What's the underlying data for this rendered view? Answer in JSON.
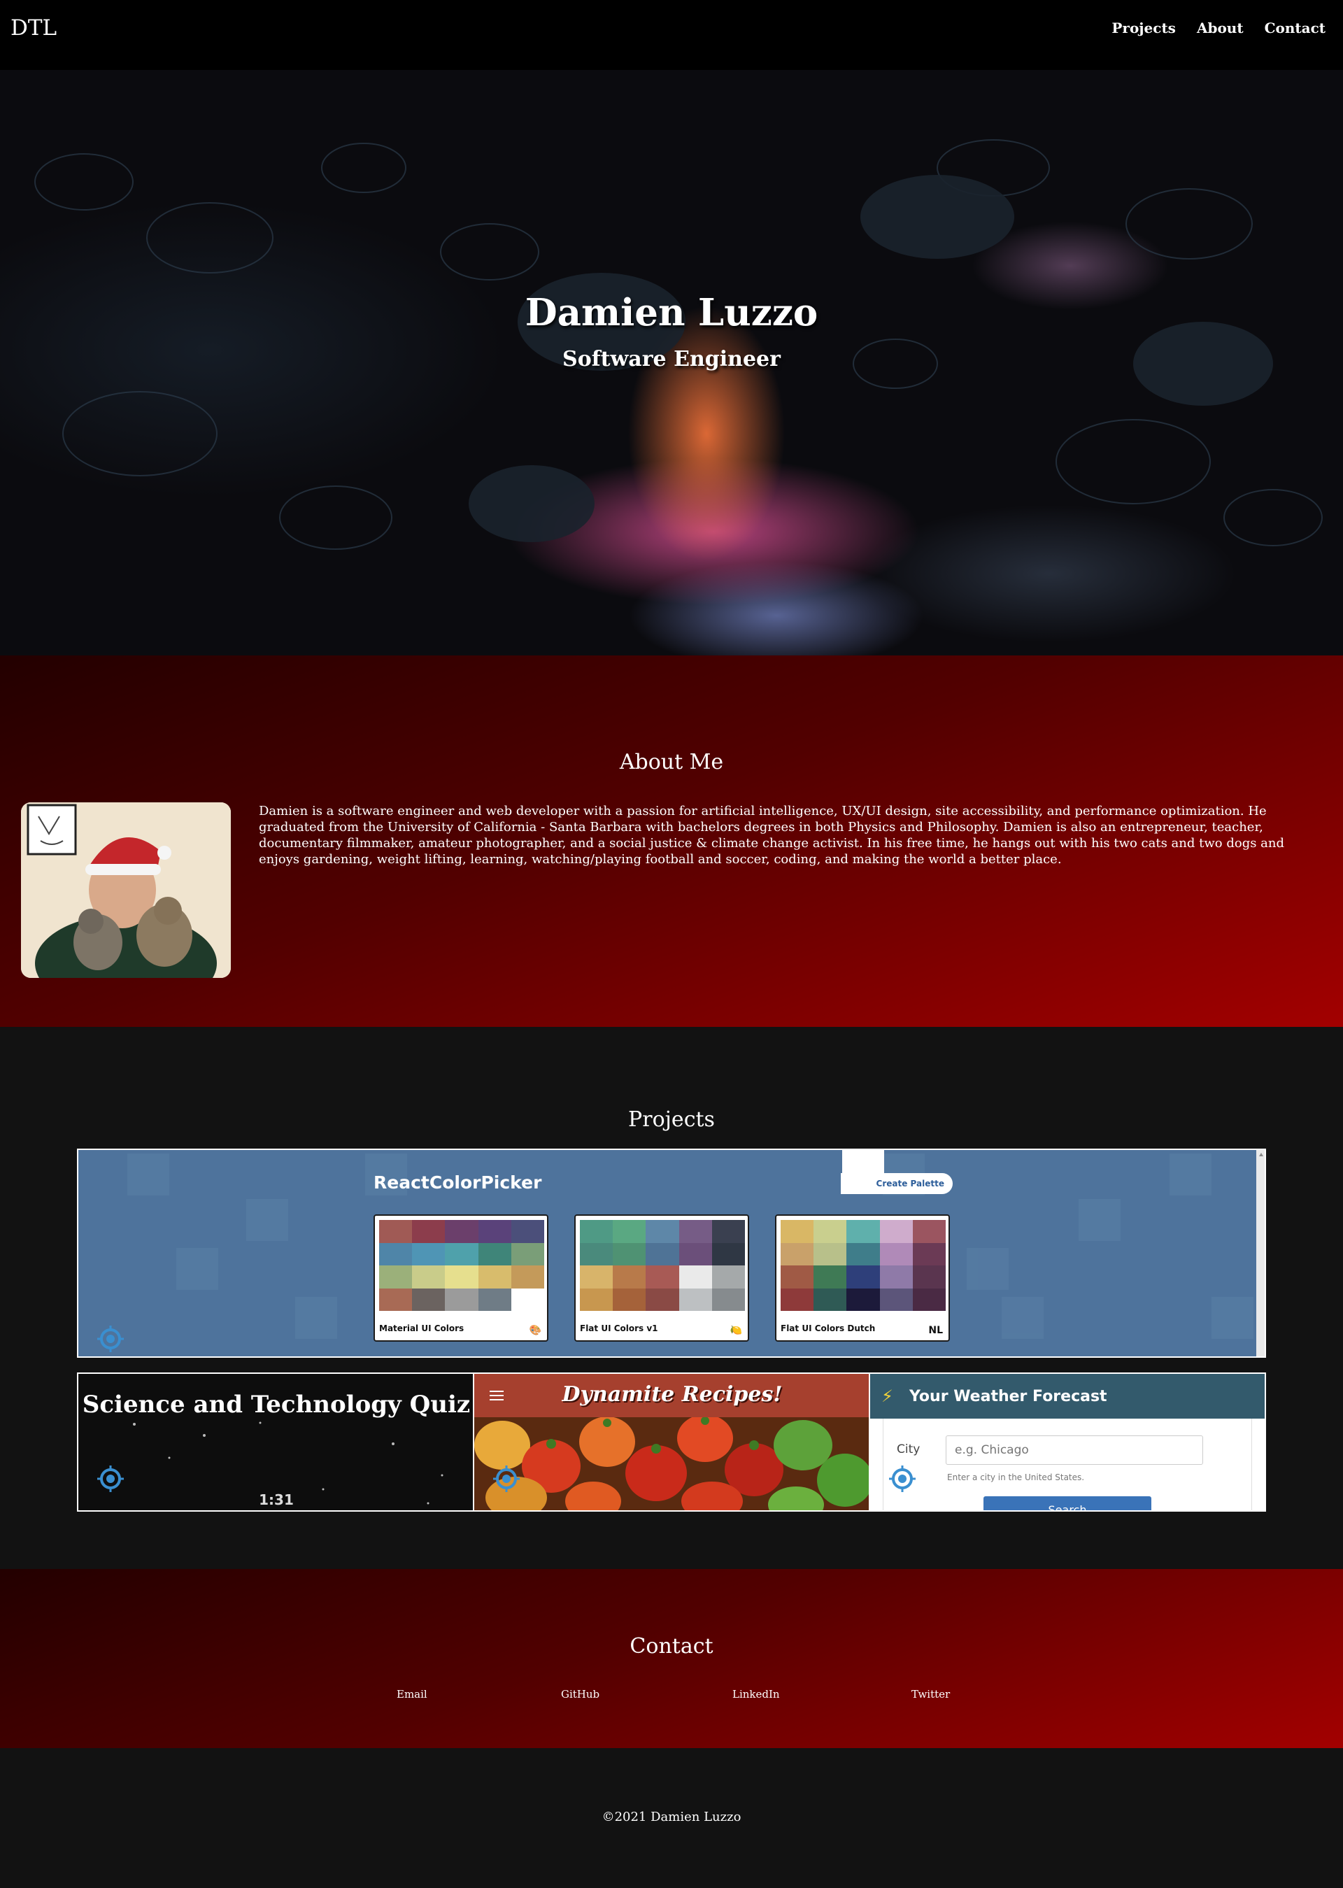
{
  "nav": {
    "brand": "DTL",
    "links": [
      "Projects",
      "About",
      "Contact"
    ]
  },
  "hero": {
    "title": "Damien Luzzo",
    "subtitle": "Software Engineer"
  },
  "about": {
    "heading": "About Me",
    "text": "Damien is a software engineer and web developer with a passion for artificial intelligence, UX/UI design, site accessibility, and performance optimization. He graduated from the University of California - Santa Barbara with bachelors degrees in both Physics and Philosophy. Damien is also an entrepreneur, teacher, documentary filmmaker, amateur photographer, and a social justice & climate change activist. In his free time, he hangs out with his two cats and two dogs and enjoys gardening, weight lifting, learning, watching/playing football and soccer, coding, and making the world a better place."
  },
  "projects": {
    "heading": "Projects",
    "color_picker": {
      "title": "ReactColorPicker",
      "create_button": "Create Palette",
      "palettes": [
        {
          "name": "Material UI Colors",
          "emoji": "🎨",
          "colors": [
            "#a05a55",
            "#8c3d4c",
            "#6b3f6b",
            "#5a427a",
            "#4b4f7a",
            "#4f85a8",
            "#4f95b5",
            "#4fa1ab",
            "#3f8579",
            "#7a9e78",
            "#9bb07a",
            "#c9cc8a",
            "#e6df8e",
            "#d8bc6c",
            "#c49a5a",
            "#a86a55",
            "#6b6360",
            "#9b9b9b",
            "#6f7c86",
            "#ffffff"
          ]
        },
        {
          "name": "Flat UI Colors v1",
          "emoji": "🍋",
          "colors": [
            "#4f9a85",
            "#5aa882",
            "#5e87a8",
            "#765c86",
            "#3a4050",
            "#4a8a7c",
            "#4f9273",
            "#4f7396",
            "#6b4f7a",
            "#2f3744",
            "#d8b46a",
            "#b87a4a",
            "#a85a55",
            "#eaeaea",
            "#a5a9aa",
            "#c8974f",
            "#a5623a",
            "#8a4a45",
            "#bdc0c2",
            "#868b8e"
          ]
        },
        {
          "name": "Flat UI Colors Dutch",
          "emoji": "NL",
          "colors": [
            "#d9b765",
            "#c9cf8e",
            "#5fb0ac",
            "#cfaccc",
            "#9b5560",
            "#c9a16a",
            "#b8c08a",
            "#3f7d8a",
            "#b08ab8",
            "#6b3a55",
            "#a05a45",
            "#3f7a55",
            "#2e3f7a",
            "#8f7aa8",
            "#5a354f",
            "#8e3a3a",
            "#2f5a55",
            "#1c1a3a",
            "#5c557a",
            "#4a2a44"
          ]
        }
      ]
    },
    "quiz": {
      "title": "Science and Technology Quiz",
      "timer": "1:31"
    },
    "recipes": {
      "title": "Dynamite Recipes!"
    },
    "weather": {
      "title": "Your Weather Forecast",
      "city_label": "City",
      "city_placeholder": "e.g. Chicago",
      "hint": "Enter a city in the United States.",
      "search_label": "Search"
    }
  },
  "contact": {
    "heading": "Contact",
    "links": [
      "Email",
      "GitHub",
      "LinkedIn",
      "Twitter"
    ]
  },
  "footer": {
    "copyright": "©2021 Damien Luzzo"
  },
  "colors": {
    "accent_red": "#a30000",
    "dark_bg": "#121212",
    "picker_blue": "#4e739c",
    "weather_header": "#335a6c",
    "recipes_header": "#a6402e"
  }
}
